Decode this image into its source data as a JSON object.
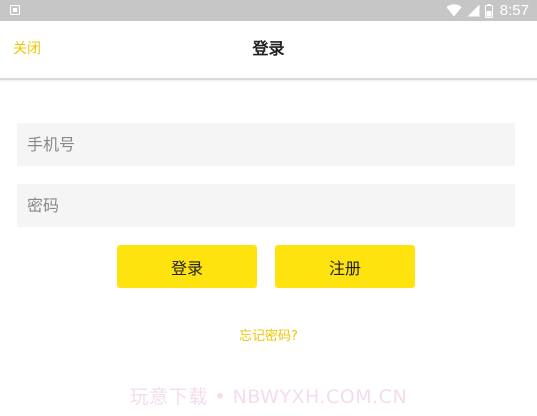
{
  "status_bar": {
    "time": "8:57",
    "icons": [
      "notification-icon",
      "wifi-icon",
      "cell-signal-icon",
      "battery-icon"
    ]
  },
  "header": {
    "close_label": "关闭",
    "title": "登录"
  },
  "form": {
    "phone_placeholder": "手机号",
    "phone_value": "",
    "password_placeholder": "密码",
    "password_value": ""
  },
  "buttons": {
    "login_label": "登录",
    "register_label": "注册"
  },
  "forgot_password_label": "忘记密码?",
  "watermark": "玩意下载 • NBWYXH.COM.CN",
  "colors": {
    "accent": "#ffe30f",
    "link": "#f3c400",
    "status_bar": "#c6c6c6",
    "field_bg": "#f5f5f5"
  }
}
